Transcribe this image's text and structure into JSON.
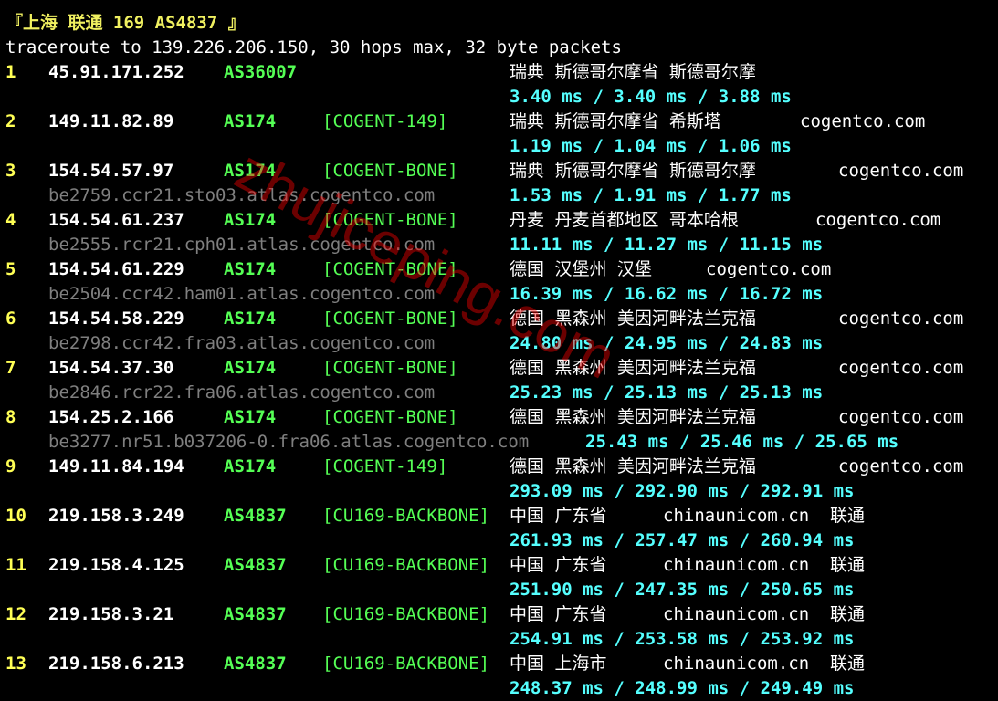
{
  "header": {
    "title": "『上海 联通 169 AS4837 』",
    "command": "traceroute to 139.226.206.150, 30 hops max, 32 byte packets"
  },
  "watermark": "zhujiceping.com",
  "colors": {
    "background": "#000000",
    "hop_number": "#ffff55",
    "ip": "#ffffff",
    "asn": "#55ff55",
    "latency": "#55ffff",
    "rdns": "#7f7f7f",
    "title": "#f0f060"
  },
  "hops": [
    {
      "hop": "1",
      "ip": "45.91.171.252",
      "asn": "AS36007",
      "tag": "",
      "geo": "瑞典 斯德哥尔摩省 斯德哥尔摩",
      "host": "",
      "rdns": "",
      "latency": "3.40 ms / 3.40 ms / 3.88 ms"
    },
    {
      "hop": "2",
      "ip": "149.11.82.89",
      "asn": "AS174",
      "tag": "[COGENT-149]",
      "geo": "瑞典 斯德哥尔摩省 希斯塔",
      "host": "cogentco.com",
      "rdns": "",
      "latency": "1.19 ms / 1.04 ms / 1.06 ms"
    },
    {
      "hop": "3",
      "ip": "154.54.57.97",
      "asn": "AS174",
      "tag": "[COGENT-BONE]",
      "geo": "瑞典 斯德哥尔摩省 斯德哥尔摩",
      "host": "cogentco.com",
      "rdns": "be2759.ccr21.sto03.atlas.cogentco.com",
      "latency": "1.53 ms / 1.91 ms / 1.77 ms"
    },
    {
      "hop": "4",
      "ip": "154.54.61.237",
      "asn": "AS174",
      "tag": "[COGENT-BONE]",
      "geo": "丹麦 丹麦首都地区 哥本哈根",
      "host": "cogentco.com",
      "rdns": "be2555.rcr21.cph01.atlas.cogentco.com",
      "latency": "11.11 ms / 11.27 ms / 11.15 ms"
    },
    {
      "hop": "5",
      "ip": "154.54.61.229",
      "asn": "AS174",
      "tag": "[COGENT-BONE]",
      "geo": "德国 汉堡州 汉堡",
      "host": "cogentco.com",
      "rdns": "be2504.ccr42.ham01.atlas.cogentco.com",
      "latency": "16.39 ms / 16.62 ms / 16.72 ms"
    },
    {
      "hop": "6",
      "ip": "154.54.58.229",
      "asn": "AS174",
      "tag": "[COGENT-BONE]",
      "geo": "德国 黑森州 美因河畔法兰克福",
      "host": "cogentco.com",
      "rdns": "be2798.ccr42.fra03.atlas.cogentco.com",
      "latency": "24.80 ms / 24.95 ms / 24.83 ms"
    },
    {
      "hop": "7",
      "ip": "154.54.37.30",
      "asn": "AS174",
      "tag": "[COGENT-BONE]",
      "geo": "德国 黑森州 美因河畔法兰克福",
      "host": "cogentco.com",
      "rdns": "be2846.rcr22.fra06.atlas.cogentco.com",
      "latency": "25.23 ms / 25.13 ms / 25.13 ms"
    },
    {
      "hop": "8",
      "ip": "154.25.2.166",
      "asn": "AS174",
      "tag": "[COGENT-BONE]",
      "geo": "德国 黑森州 美因河畔法兰克福",
      "host": "cogentco.com",
      "rdns": "be3277.nr51.b037206-0.fra06.atlas.cogentco.com",
      "latency": "25.43 ms / 25.46 ms / 25.65 ms"
    },
    {
      "hop": "9",
      "ip": "149.11.84.194",
      "asn": "AS174",
      "tag": "[COGENT-149]",
      "geo": "德国 黑森州 美因河畔法兰克福",
      "host": "cogentco.com",
      "rdns": "",
      "latency": "293.09 ms / 292.90 ms / 292.91 ms"
    },
    {
      "hop": "10",
      "ip": "219.158.3.249",
      "asn": "AS4837",
      "tag": "[CU169-BACKBONE]",
      "geo": "中国 广东省",
      "host": "chinaunicom.cn  联通",
      "rdns": "",
      "latency": "261.93 ms / 257.47 ms / 260.94 ms"
    },
    {
      "hop": "11",
      "ip": "219.158.4.125",
      "asn": "AS4837",
      "tag": "[CU169-BACKBONE]",
      "geo": "中国 广东省",
      "host": "chinaunicom.cn  联通",
      "rdns": "",
      "latency": "251.90 ms / 247.35 ms / 250.65 ms"
    },
    {
      "hop": "12",
      "ip": "219.158.3.21",
      "asn": "AS4837",
      "tag": "[CU169-BACKBONE]",
      "geo": "中国 广东省",
      "host": "chinaunicom.cn  联通",
      "rdns": "",
      "latency": "254.91 ms / 253.58 ms / 253.92 ms"
    },
    {
      "hop": "13",
      "ip": "219.158.6.213",
      "asn": "AS4837",
      "tag": "[CU169-BACKBONE]",
      "geo": "中国 上海市",
      "host": "chinaunicom.cn  联通",
      "rdns": "",
      "latency": "248.37 ms / 248.99 ms / 249.49 ms"
    }
  ]
}
